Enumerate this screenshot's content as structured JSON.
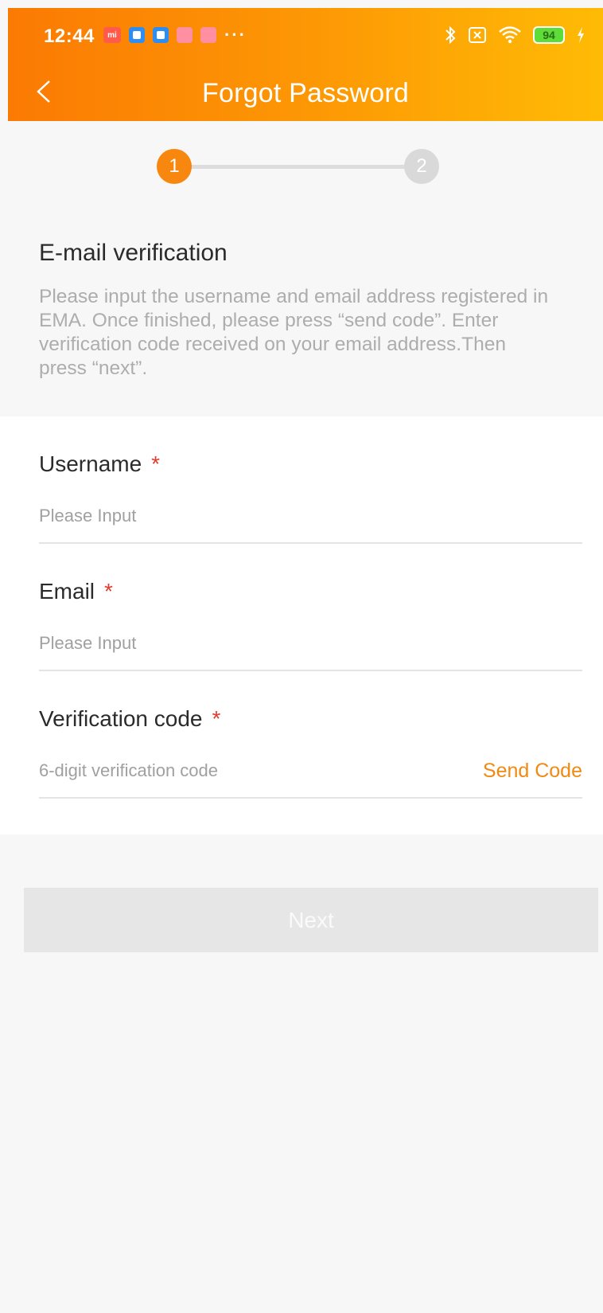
{
  "status_bar": {
    "time": "12:44",
    "notification_icons": [
      "mi",
      "app-blue",
      "app-blue",
      "app-pink",
      "app-pink"
    ],
    "more": "···",
    "battery": "94"
  },
  "nav": {
    "title": "Forgot Password"
  },
  "stepper": {
    "steps": [
      "1",
      "2"
    ],
    "active_color": "#f7870e",
    "inactive_color": "#d9d9d9"
  },
  "section": {
    "title": "E-mail verification",
    "description": "Please input the username and email address registered in EMA. Once finished, please press “send code”. Enter verification code received on your email address.Then press “next”."
  },
  "form": {
    "username": {
      "label": "Username",
      "required": "*",
      "placeholder": "Please Input"
    },
    "email": {
      "label": "Email",
      "required": "*",
      "placeholder": "Please Input"
    },
    "code": {
      "label": "Verification code",
      "required": "*",
      "placeholder": "6-digit verification code",
      "send_label": "Send Code"
    }
  },
  "next_label": "Next",
  "colors": {
    "accent": "#f08a12",
    "header_gradient_start": "#fb7a03",
    "header_gradient_end": "#ffbb05"
  }
}
